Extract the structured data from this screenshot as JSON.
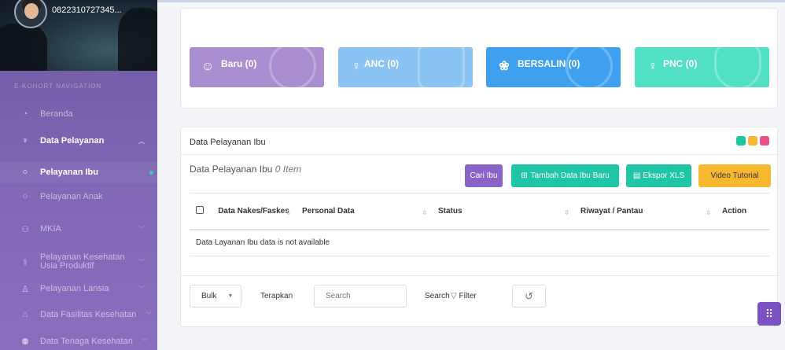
{
  "user": {
    "phone": "0822310727345..."
  },
  "nav": {
    "title": "E-KOHORT NAVIGATION",
    "items": [
      {
        "label": "Beranda",
        "icon": "speedometer-icon"
      },
      {
        "label": "Data Pelayanan",
        "icon": "female-icon"
      },
      {
        "label": "Pelayanan Ibu",
        "icon": "circle-icon"
      },
      {
        "label": "Pelayanan Anak",
        "icon": "circle-icon"
      },
      {
        "label": "MKIA",
        "icon": "people-icon"
      },
      {
        "label": "Pelayanan Kesehatan Usia Produktif",
        "icon": "stethoscope-icon"
      },
      {
        "label": "Pelayanan Lansia",
        "icon": "elder-icon"
      },
      {
        "label": "Data Fasilitas Kesehatan",
        "icon": "hospital-icon"
      },
      {
        "label": "Data Tenaga Kesehatan",
        "icon": "staff-icon"
      }
    ]
  },
  "stats": [
    {
      "label": "Baru (0)",
      "color": "#a98fcf",
      "icon": "new-badge-icon"
    },
    {
      "label": "ANC (0)",
      "color": "#8bc3f2",
      "icon": "pregnant-icon"
    },
    {
      "label": "BERSALIN (0)",
      "color": "#3fa0f0",
      "icon": "baby-icon"
    },
    {
      "label": "PNC (0)",
      "color": "#52e0c4",
      "icon": "mother-icon"
    }
  ],
  "panel": {
    "title": "Data Pelayanan Ibu",
    "subtitle": "Data Pelayanan Ibu",
    "count": "0 Item",
    "buttons": {
      "cari": "Cari Ibu",
      "tambah": "Tambah Data Ibu Baru",
      "ekspor": "Ekspor XLS",
      "video": "Video Tutorial"
    },
    "columns": [
      "Data Nakes/Faskes",
      "Personal Data",
      "Status",
      "Riwayat / Pantau",
      "Action"
    ],
    "empty": "Data Layanan Ibu data is not available"
  },
  "footer": {
    "bulk": "Bulk",
    "terapkan": "Terapkan",
    "search_placeholder": "Search",
    "search_label": "Search",
    "filter": "Filter"
  },
  "colors": {
    "purple": "#8a63c8",
    "teal": "#1fc6a6",
    "yellow": "#f7b830",
    "pink": "#f04e8a"
  }
}
